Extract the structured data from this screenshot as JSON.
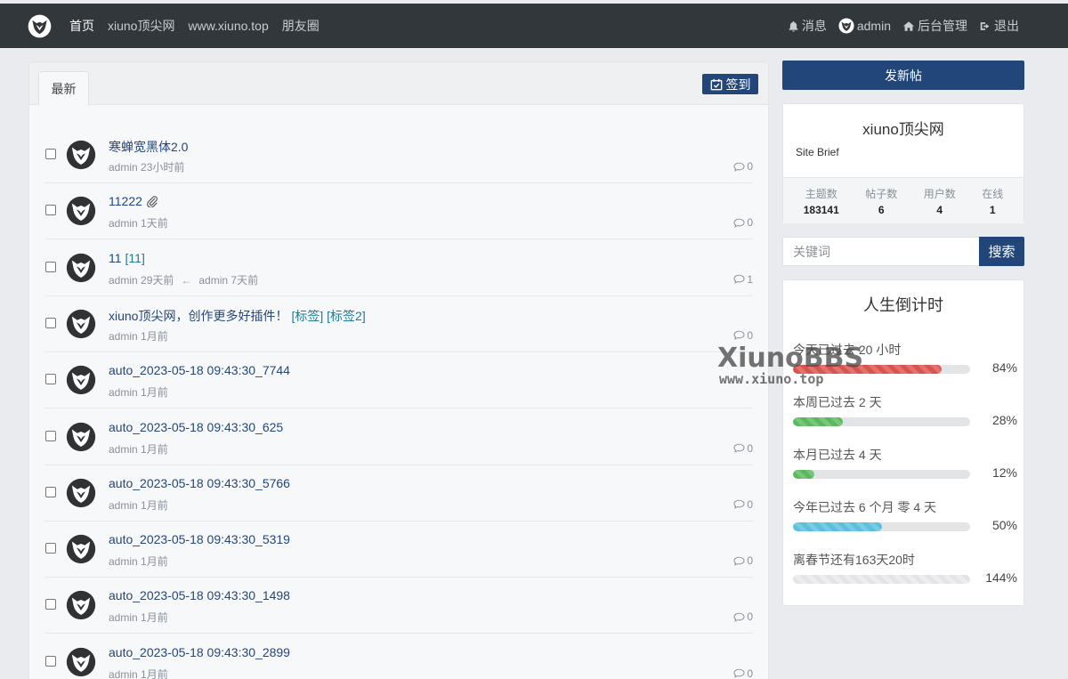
{
  "nav": {
    "links": [
      {
        "label": "首页",
        "active": true
      },
      {
        "label": "xiuno顶尖网"
      },
      {
        "label": "www.xiuno.top"
      },
      {
        "label": "朋友圈"
      }
    ],
    "right": {
      "messages": "消息",
      "user": "admin",
      "admin": "后台管理",
      "logout": "退出"
    }
  },
  "main": {
    "tab": "最新",
    "checkin": "签到",
    "threads": [
      {
        "title": "寒蝉宽黑体2.0",
        "tags": "",
        "meta": "admin  23小时前",
        "meta2": "",
        "replies": "0"
      },
      {
        "title": "11222",
        "tags": "",
        "meta": "admin  1天前",
        "meta2": "",
        "replies": "0",
        "attachment": true
      },
      {
        "title": "11",
        "tags": "[11]",
        "meta": "admin  29天前",
        "meta2": "admin  7天前",
        "replies": "1"
      },
      {
        "title": "xiuno顶尖网，创作更多好插件！",
        "tags": "[标签] [标签2]",
        "meta": "admin  1月前",
        "meta2": "",
        "replies": "0"
      },
      {
        "title": "auto_2023-05-18 09:43:30_7744",
        "tags": "",
        "meta": "admin  1月前",
        "meta2": "",
        "replies": ""
      },
      {
        "title": "auto_2023-05-18 09:43:30_625",
        "tags": "",
        "meta": "admin  1月前",
        "meta2": "",
        "replies": "0"
      },
      {
        "title": "auto_2023-05-18 09:43:30_5766",
        "tags": "",
        "meta": "admin  1月前",
        "meta2": "",
        "replies": "0"
      },
      {
        "title": "auto_2023-05-18 09:43:30_5319",
        "tags": "",
        "meta": "admin  1月前",
        "meta2": "",
        "replies": "0"
      },
      {
        "title": "auto_2023-05-18 09:43:30_1498",
        "tags": "",
        "meta": "admin  1月前",
        "meta2": "",
        "replies": "0"
      },
      {
        "title": "auto_2023-05-18 09:43:30_2899",
        "tags": "",
        "meta": "admin  1月前",
        "meta2": "",
        "replies": "0"
      }
    ]
  },
  "sidebar": {
    "new_post": "发新帖",
    "site": {
      "name": "xiuno顶尖网",
      "brief": "Site Brief",
      "stats": [
        {
          "label": "主题数",
          "value": "183141"
        },
        {
          "label": "帖子数",
          "value": "6"
        },
        {
          "label": "用户数",
          "value": "4"
        },
        {
          "label": "在线",
          "value": "1"
        }
      ]
    },
    "search": {
      "placeholder": "关键词",
      "button": "搜索"
    },
    "life": {
      "title": "人生倒计时",
      "rows": [
        {
          "label": "今天已过去 20 小时",
          "percent": "84%",
          "fill": 0.84,
          "color": "#d9534f"
        },
        {
          "label": "本周已过去 2 天",
          "percent": "28%",
          "fill": 0.28,
          "color": "#5cb85c"
        },
        {
          "label": "本月已过去 4 天",
          "percent": "12%",
          "fill": 0.12,
          "color": "#5cb85c"
        },
        {
          "label": "今年已过去 6 个月 零 4 天",
          "percent": "50%",
          "fill": 0.5,
          "color": "#5bc0de"
        },
        {
          "label": "离春节还有163天20时",
          "percent": "144%",
          "fill": 0.0,
          "color": "#e3e4e6"
        }
      ]
    }
  },
  "watermark": {
    "line1": "XiunoBBS",
    "line2": "www.xiuno.top"
  }
}
